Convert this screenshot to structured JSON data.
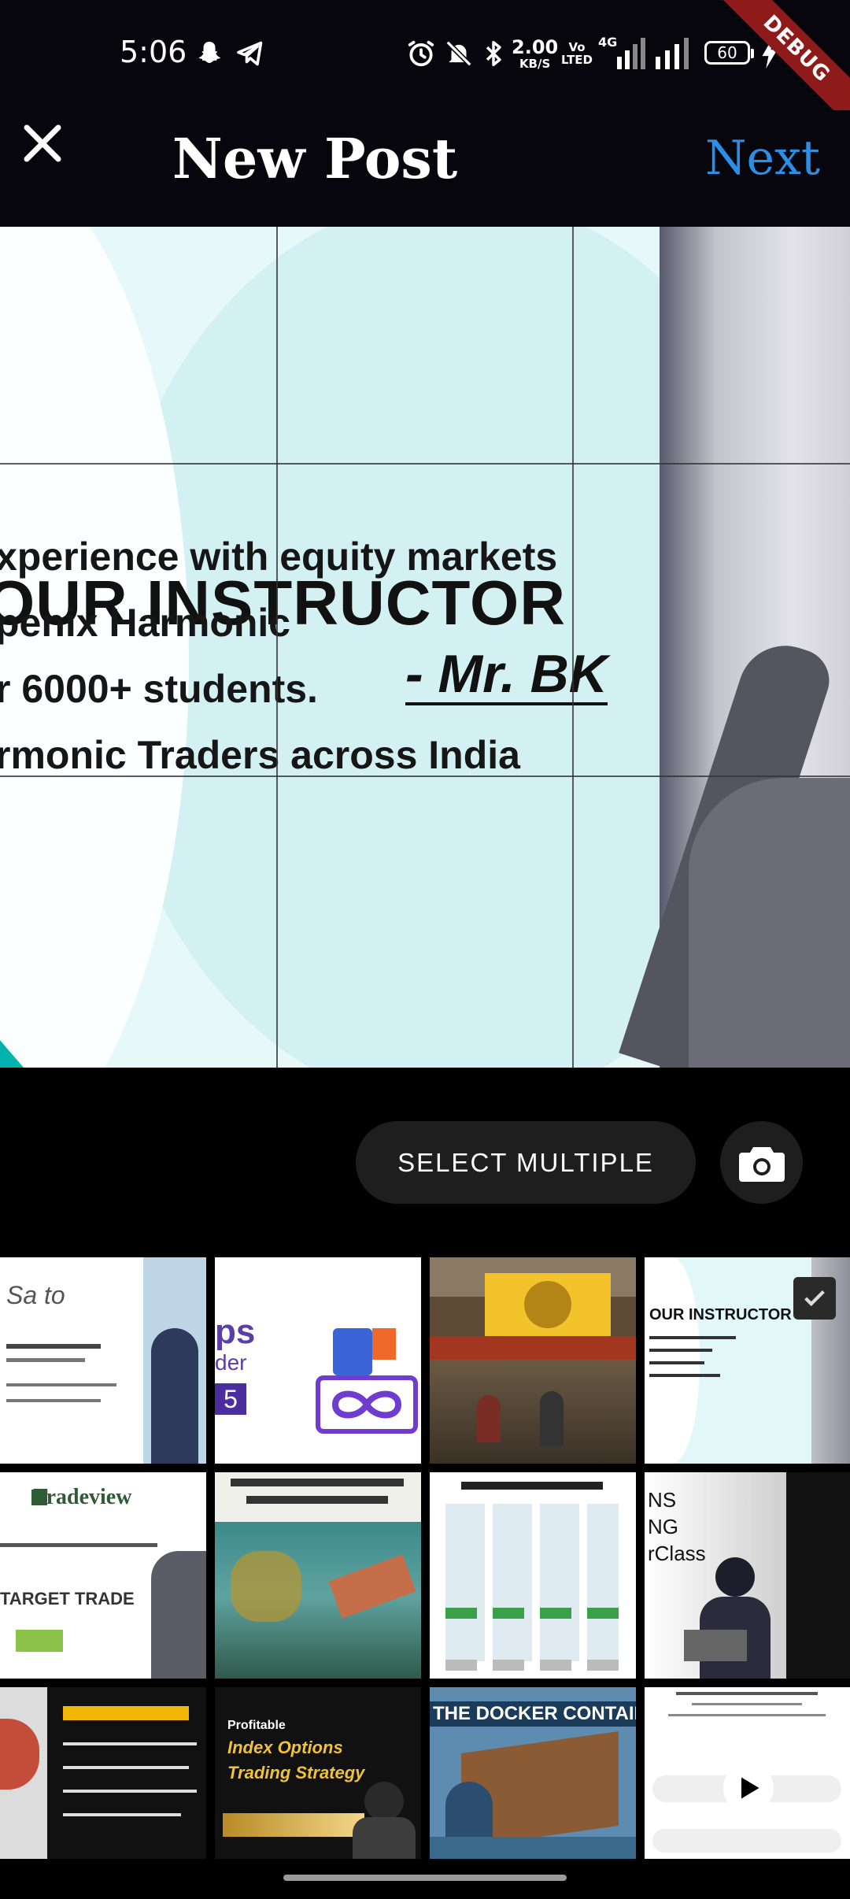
{
  "status_bar": {
    "time": "5:06",
    "speed_value": "2.00",
    "speed_unit": "KB/S",
    "volte_top": "Vo",
    "volte_bottom": "LTED",
    "network": "4G",
    "battery": "60",
    "debug_banner": "DEBUG",
    "icons": [
      "snapchat-icon",
      "telegram-icon",
      "alarm-icon",
      "mute-icon",
      "bluetooth-icon",
      "signal-icon",
      "signal-icon",
      "charging-icon"
    ]
  },
  "appbar": {
    "title": "New Post",
    "next_label": "Next",
    "close_icon": "close-icon",
    "next_color": "#2b8fe8"
  },
  "preview": {
    "heading": "OUR  INSTRUCTOR",
    "subheading": "- Mr. BK",
    "lines": [
      "xperience with equity markets",
      "penix Harmonic",
      "r 6000+ students.",
      "rmonic Traders across India"
    ]
  },
  "actions": {
    "select_multiple_label": "SELECT MULTIPLE",
    "camera_icon": "camera-icon"
  },
  "gallery": {
    "thumbs": [
      {
        "text": "Sa to",
        "selected": false
      },
      {
        "text": "ps",
        "text2": "der",
        "text3": "5",
        "selected": false
      },
      {
        "text": "",
        "selected": false
      },
      {
        "text": "OUR INSTRUCTOR",
        "selected": true
      },
      {
        "text": "Tradeview",
        "text2": "TARGET TRADE",
        "selected": false
      },
      {
        "text": "",
        "selected": false
      },
      {
        "text": "",
        "selected": false
      },
      {
        "text": "NS",
        "text2": "NG",
        "text3": "rClass",
        "selected": false
      },
      {
        "text": "",
        "selected": false
      },
      {
        "text": "Profitable",
        "text2": "Index Options",
        "text3": "Trading Strategy",
        "selected": false
      },
      {
        "text": "THE DOCKER CONTAINER",
        "selected": false
      },
      {
        "text": "",
        "selected": false
      }
    ]
  }
}
